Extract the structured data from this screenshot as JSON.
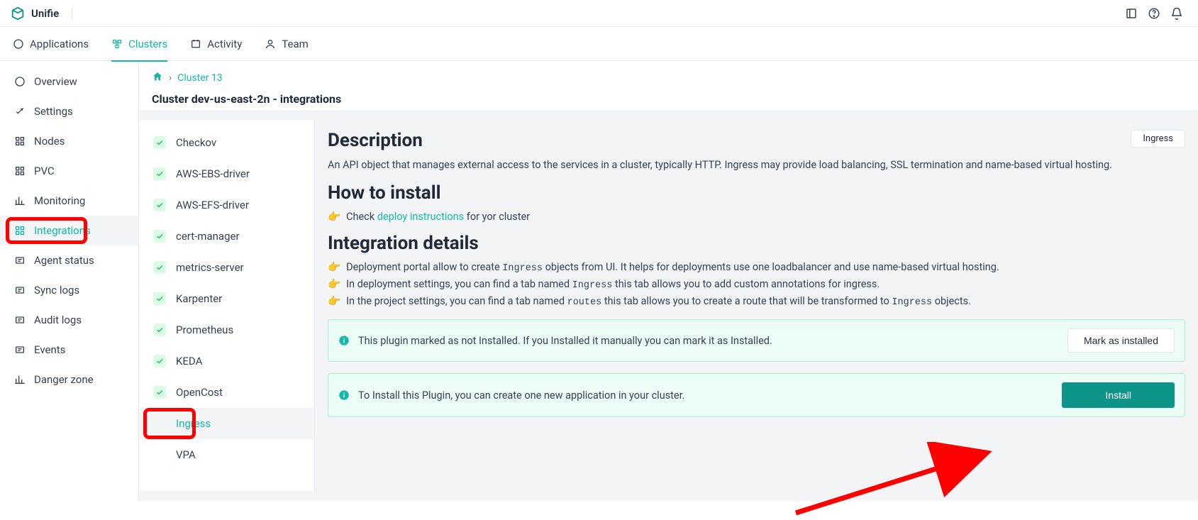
{
  "brand": "Unifie",
  "top_icons": {
    "tab": "tab-icon",
    "help": "help-icon",
    "bell": "bell-icon"
  },
  "nav": {
    "items": [
      {
        "label": "Applications"
      },
      {
        "label": "Clusters"
      },
      {
        "label": "Activity"
      },
      {
        "label": "Team"
      }
    ],
    "active_index": 1
  },
  "sidebar": {
    "items": [
      {
        "label": "Overview"
      },
      {
        "label": "Settings"
      },
      {
        "label": "Nodes"
      },
      {
        "label": "PVC"
      },
      {
        "label": "Monitoring"
      },
      {
        "label": "Integrations"
      },
      {
        "label": "Agent status"
      },
      {
        "label": "Sync logs"
      },
      {
        "label": "Audit logs"
      },
      {
        "label": "Events"
      },
      {
        "label": "Danger zone"
      }
    ],
    "active_index": 5
  },
  "breadcrumb": {
    "link_label": "Cluster 13",
    "page_title": "Cluster dev-us-east-2n - integrations"
  },
  "integrations_list": {
    "items": [
      {
        "label": "Checkov",
        "installed": true
      },
      {
        "label": "AWS-EBS-driver",
        "installed": true
      },
      {
        "label": "AWS-EFS-driver",
        "installed": true
      },
      {
        "label": "cert-manager",
        "installed": true
      },
      {
        "label": "metrics-server",
        "installed": true
      },
      {
        "label": "Karpenter",
        "installed": true
      },
      {
        "label": "Prometheus",
        "installed": true
      },
      {
        "label": "KEDA",
        "installed": true
      },
      {
        "label": "OpenCost",
        "installed": true
      },
      {
        "label": "Ingress",
        "installed": false
      },
      {
        "label": "VPA",
        "installed": false
      }
    ],
    "selected_index": 9
  },
  "detail": {
    "badge": "Ingress",
    "sections": {
      "description_heading": "Description",
      "description_body": "An API object that manages external access to the services in a cluster, typically HTTP. Ingress may provide load balancing, SSL termination and name-based virtual hosting.",
      "how_heading": "How to install",
      "how_prefix": "Check ",
      "how_link": "deploy instructions",
      "how_suffix": " for yor cluster",
      "details_heading": "Integration details",
      "bullets": [
        {
          "pre": "Deployment portal allow to create ",
          "code": "Ingress",
          "post": " objects from UI. It helps for deployments use one loadbalancer and use name-based virtual hosting."
        },
        {
          "pre": "In deployment settings, you can find a tab named ",
          "code": "Ingress",
          "post": " this tab allows you to add custom annotations for ingress."
        },
        {
          "pre": "In the project settings, you can find a tab named ",
          "code": "routes",
          "post_pre": " this tab allows you to create a route that will be transformed to ",
          "code2": "Ingress",
          "post": " objects."
        }
      ]
    },
    "alerts": [
      {
        "msg": "This plugin marked as not Installed. If you Installed it manually you can mark it as Installed.",
        "btn": "Mark as installed",
        "btn_kind": "secondary"
      },
      {
        "msg": "To Install this Plugin, you can create one new application in your cluster.",
        "btn": "Install",
        "btn_kind": "primary"
      }
    ]
  },
  "annotations": {
    "highlight_sidebar_index": 5,
    "highlight_integration_index": 9,
    "arrow_to_install": true
  }
}
